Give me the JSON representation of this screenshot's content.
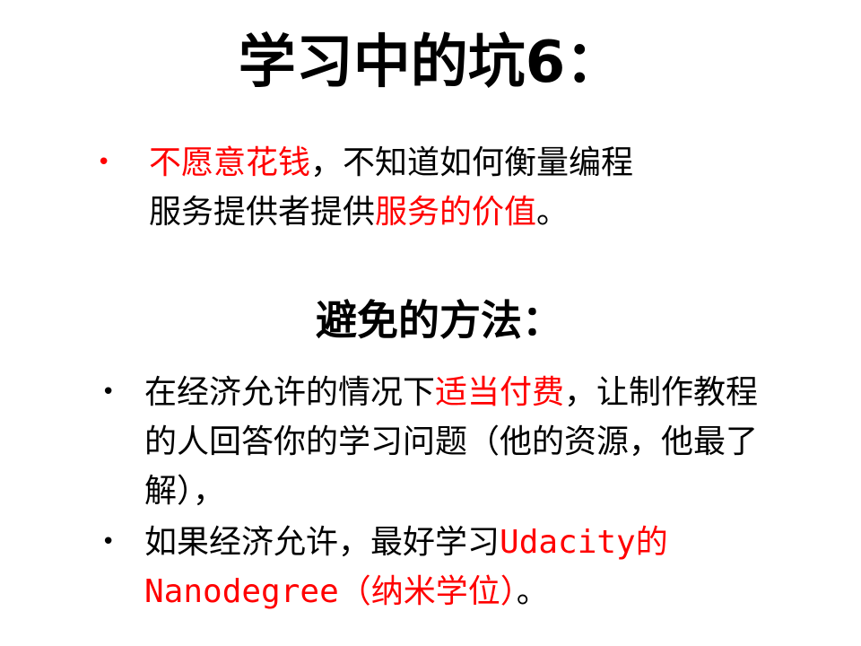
{
  "slide": {
    "title": "学习中的坑6：",
    "subtitle": "避免的方法：",
    "bullet_glyph": "•",
    "colors": {
      "text": "#000000",
      "highlight": "#ff0000",
      "background": "#ffffff"
    },
    "bullets": [
      {
        "line1_red": "不愿意花钱",
        "line1_black": "，不知道如何衡量编程",
        "line2_black": "服务提供者提供",
        "line2_red": "服务的价值",
        "line2_end": "。"
      },
      {
        "part1": "在经济允许的情况下",
        "part2_red": "适当付费",
        "part3": "，让制作教程的人回答你的学习问题（他的资源，他最了解），"
      },
      {
        "part1": "如果经济允许，最好学习",
        "part2_red": "Udacity的Nanodegree（纳米学位）",
        "part3": "。"
      }
    ]
  }
}
